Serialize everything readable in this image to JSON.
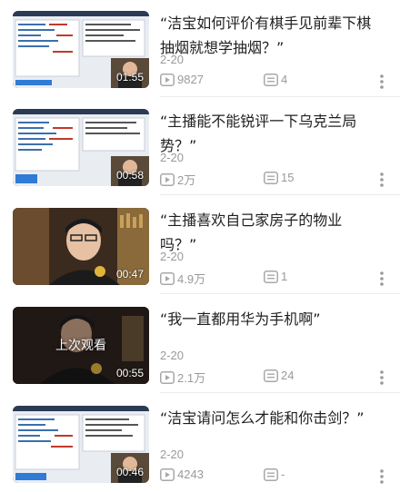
{
  "videos": [
    {
      "title": "“洁宝如何评价有棋手见前辈下棋抽烟就想学抽烟？”",
      "date": "2-20",
      "views": "9827",
      "comments": "4",
      "duration": "01:55",
      "watched_label": "",
      "thumb_kind": "screen"
    },
    {
      "title": "“主播能不能锐评一下乌克兰局势？”",
      "date": "2-20",
      "views": "2万",
      "comments": "15",
      "duration": "00:58",
      "watched_label": "",
      "thumb_kind": "screen"
    },
    {
      "title": "“主播喜欢自己家房子的物业吗？”",
      "date": "2-20",
      "views": "4.9万",
      "comments": "1",
      "duration": "00:47",
      "watched_label": "",
      "thumb_kind": "person"
    },
    {
      "title": "“我一直都用华为手机啊”",
      "date": "2-20",
      "views": "2.1万",
      "comments": "24",
      "duration": "00:55",
      "watched_label": "上次观看",
      "thumb_kind": "person-dark"
    },
    {
      "title": "“洁宝请问怎么才能和你击剑？”",
      "date": "2-20",
      "views": "4243",
      "comments": "-",
      "duration": "00:46",
      "watched_label": "",
      "thumb_kind": "screen"
    }
  ],
  "icons": {
    "views": "play-count-icon",
    "comments": "comment-count-icon",
    "more": "more-vertical-icon"
  },
  "colors": {
    "meta_text": "#9a9a9a",
    "title_text": "#1f1f1f"
  }
}
